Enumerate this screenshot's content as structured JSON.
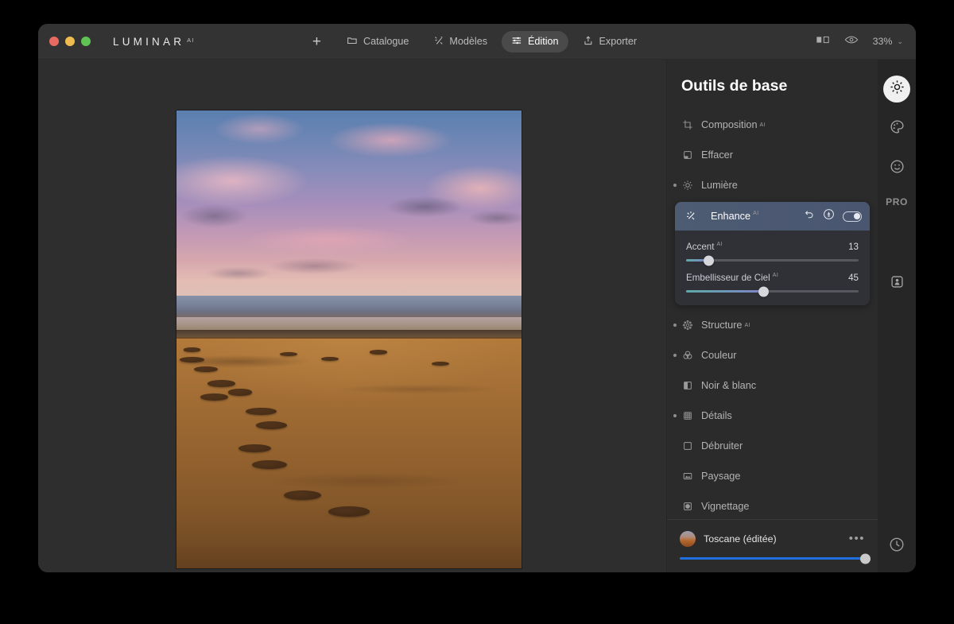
{
  "app": {
    "brand": "LUMINAR",
    "brand_superscript": "AI"
  },
  "titlebar": {
    "add_label": "+",
    "nav": [
      {
        "label": "Catalogue",
        "icon": "folder-icon",
        "active": false
      },
      {
        "label": "Modèles",
        "icon": "sparkle-icon",
        "active": false
      },
      {
        "label": "Édition",
        "icon": "sliders-icon",
        "active": true
      },
      {
        "label": "Exporter",
        "icon": "share-icon",
        "active": false
      }
    ],
    "compare_icon": "compare-icon",
    "preview_icon": "eye-icon",
    "zoom_value": "33%",
    "zoom_chevron": "⌄"
  },
  "panel": {
    "title": "Outils de base",
    "tools": [
      {
        "label": "Composition",
        "superscript": "AI",
        "icon": "crop-icon",
        "modified": false
      },
      {
        "label": "Effacer",
        "superscript": "",
        "icon": "eraser-icon",
        "modified": false
      },
      {
        "label": "Lumière",
        "superscript": "",
        "icon": "sun-icon",
        "modified": true
      }
    ],
    "tools_after": [
      {
        "label": "Structure",
        "superscript": "AI",
        "icon": "structure-icon",
        "modified": true
      },
      {
        "label": "Couleur",
        "superscript": "",
        "icon": "color-rings-icon",
        "modified": true
      },
      {
        "label": "Noir & blanc",
        "superscript": "",
        "icon": "bw-icon",
        "modified": false
      },
      {
        "label": "Détails",
        "superscript": "",
        "icon": "grid-detail-icon",
        "modified": true
      },
      {
        "label": "Débruiter",
        "superscript": "",
        "icon": "square-icon",
        "modified": false
      },
      {
        "label": "Paysage",
        "superscript": "",
        "icon": "landscape-icon",
        "modified": false
      },
      {
        "label": "Vignettage",
        "superscript": "",
        "icon": "vignette-icon",
        "modified": false
      }
    ],
    "card": {
      "title": "Enhance",
      "superscript": "AI",
      "reset_icon": "undo-icon",
      "mask_icon": "mask-brush-icon",
      "toggle_icon": "toggle-on-icon",
      "sliders": [
        {
          "label": "Accent",
          "superscript": "AI",
          "value": "13",
          "percent": 13
        },
        {
          "label": "Embellisseur de Ciel",
          "superscript": "AI",
          "value": "45",
          "percent": 45
        }
      ]
    },
    "bottom": {
      "preset_name": "Toscane (éditée)",
      "menu_label": "•••",
      "thumb_icon": "preset-thumbnail",
      "amount_percent": 100
    }
  },
  "rail": {
    "items": [
      {
        "name": "essentials-sun",
        "icon": "sun-icon",
        "active": true
      },
      {
        "name": "creative-palette",
        "icon": "palette-icon",
        "active": false
      },
      {
        "name": "portrait-smiley",
        "icon": "smiley-icon",
        "active": false
      }
    ],
    "pro_label": "PRO",
    "layers_icon": "layers-portrait-icon",
    "history_icon": "clock-history-icon"
  },
  "photo": {
    "alt": "sunset-beach-footprints-photo"
  }
}
